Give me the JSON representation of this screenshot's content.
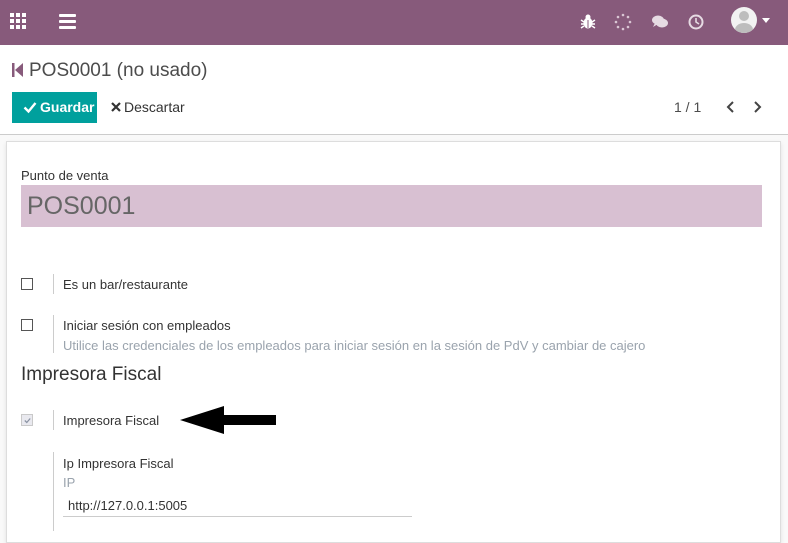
{
  "record": {
    "title": "POS0001 (no usado)"
  },
  "toolbar": {
    "save_label": "Guardar",
    "discard_label": "Descartar"
  },
  "pager": {
    "value": "1 / 1"
  },
  "form": {
    "pos_label": "Punto de venta",
    "pos_name": "POS0001",
    "options": [
      {
        "label": "Es un bar/restaurante",
        "checked": false
      },
      {
        "label": "Iniciar sesión con empleados",
        "help": "Utilice las credenciales de los empleados para iniciar sesión en la sesión de PdV y cambiar de cajero",
        "checked": false
      }
    ],
    "section_title": "Impresora Fiscal",
    "fiscal": {
      "label": "Impresora Fiscal",
      "checked": true,
      "ip_label": "Ip Impresora Fiscal",
      "ip_help": "IP",
      "ip_value": "http://127.0.0.1:5005"
    }
  },
  "colors": {
    "navbar": "#875a7b",
    "primary_button": "#00a09d",
    "title_field_bg": "#d8c0d2"
  },
  "icons": [
    "apps-grid-icon",
    "hamburger-menu-icon",
    "bug-icon",
    "spinner-icon",
    "chat-icon",
    "clock-icon",
    "user-avatar-icon",
    "breadcrumb-back-icon",
    "check-icon",
    "close-icon",
    "chevron-left-icon",
    "chevron-right-icon",
    "arrow-annotation-icon"
  ]
}
